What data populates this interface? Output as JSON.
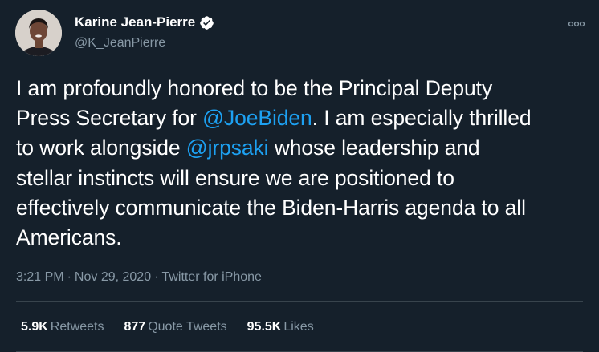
{
  "author": {
    "display_name": "Karine Jean-Pierre",
    "handle": "@K_JeanPierre",
    "verified": true
  },
  "tweet": {
    "lines": [
      [
        {
          "text": "I am profoundly honored to be the Principal Deputy",
          "type": "text"
        }
      ],
      [
        {
          "text": "Press Secretary for ",
          "type": "text"
        },
        {
          "text": "@JoeBiden",
          "type": "mention"
        },
        {
          "text": ". I am especially thrilled",
          "type": "text"
        }
      ],
      [
        {
          "text": "to work alongside ",
          "type": "text"
        },
        {
          "text": "@jrpsaki",
          "type": "mention"
        },
        {
          "text": " whose leadership and",
          "type": "text"
        }
      ],
      [
        {
          "text": "stellar instincts will ensure we are positioned to",
          "type": "text"
        }
      ],
      [
        {
          "text": "effectively communicate the Biden-Harris agenda to all",
          "type": "text"
        }
      ],
      [
        {
          "text": "Americans.",
          "type": "text"
        }
      ]
    ]
  },
  "meta": {
    "time": "3:21 PM",
    "separator": "·",
    "date": "Nov 29, 2020",
    "source": "Twitter for iPhone"
  },
  "stats": {
    "retweets": {
      "value": "5.9K",
      "label": "Retweets"
    },
    "quote_tweets": {
      "value": "877",
      "label": "Quote Tweets"
    },
    "likes": {
      "value": "95.5K",
      "label": "Likes"
    }
  },
  "colors": {
    "background": "#15202b",
    "text": "#ffffff",
    "secondary": "#8899a6",
    "accent": "#1da1f2",
    "divider": "#38444d"
  },
  "icons": {
    "verified": "verified-badge-icon",
    "more": "more-options-icon"
  }
}
